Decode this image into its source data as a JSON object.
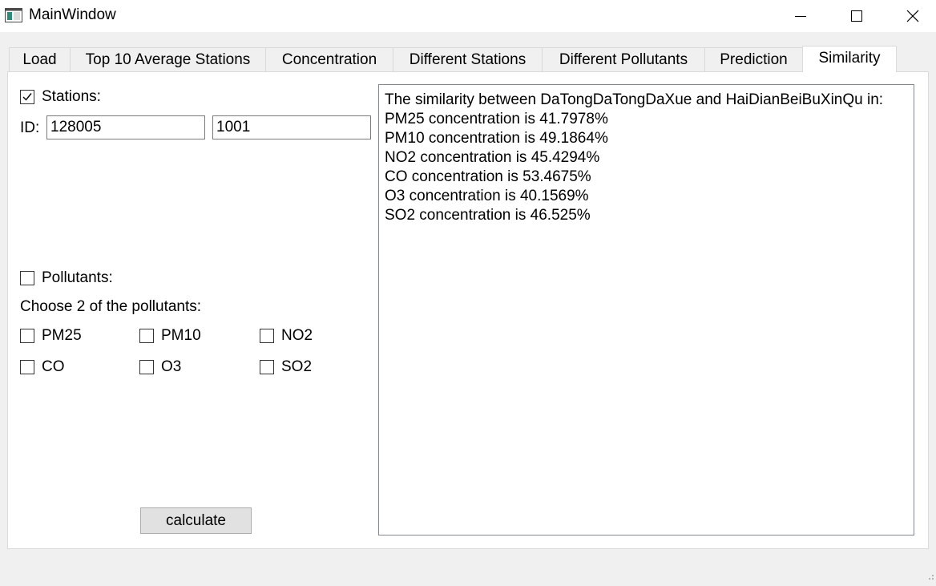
{
  "window": {
    "title": "MainWindow",
    "icon": "app-window-icon",
    "controls": [
      "minimize-icon",
      "maximize-icon",
      "close-icon"
    ]
  },
  "tabs": [
    {
      "label": "Load",
      "active": false
    },
    {
      "label": "Top 10 Average Stations",
      "active": false
    },
    {
      "label": "Concentration",
      "active": false
    },
    {
      "label": "Different Stations",
      "active": false
    },
    {
      "label": "Different Pollutants",
      "active": false
    },
    {
      "label": "Prediction",
      "active": false
    },
    {
      "label": "Similarity",
      "active": true
    }
  ],
  "form": {
    "stations_label": "Stations:",
    "stations_checked": true,
    "id_label": "ID:",
    "id1_value": "128005",
    "id2_value": "1001",
    "pollutants_label": "Pollutants:",
    "pollutants_checked": false,
    "choose_label": "Choose 2 of the pollutants:",
    "pollutants": [
      {
        "label": "PM25",
        "checked": false
      },
      {
        "label": "PM10",
        "checked": false
      },
      {
        "label": "NO2",
        "checked": false
      },
      {
        "label": "CO",
        "checked": false
      },
      {
        "label": "O3",
        "checked": false
      },
      {
        "label": "SO2",
        "checked": false
      }
    ],
    "calculate_label": "calculate"
  },
  "output": {
    "lines": [
      "The similarity between DaTongDaTongDaXue and HaiDianBeiBuXinQu in:",
      "PM25 concentration is 41.7978%",
      "PM10 concentration is 49.1864%",
      "NO2 concentration is 45.4294%",
      "CO concentration is 53.4675%",
      "O3 concentration is 40.1569%",
      "SO2 concentration is 46.525%"
    ]
  },
  "colors": {
    "window_bg": "#f0f0f0",
    "panel_bg": "#ffffff",
    "border": "#d9d9d9",
    "button_bg": "#e1e1e1"
  }
}
